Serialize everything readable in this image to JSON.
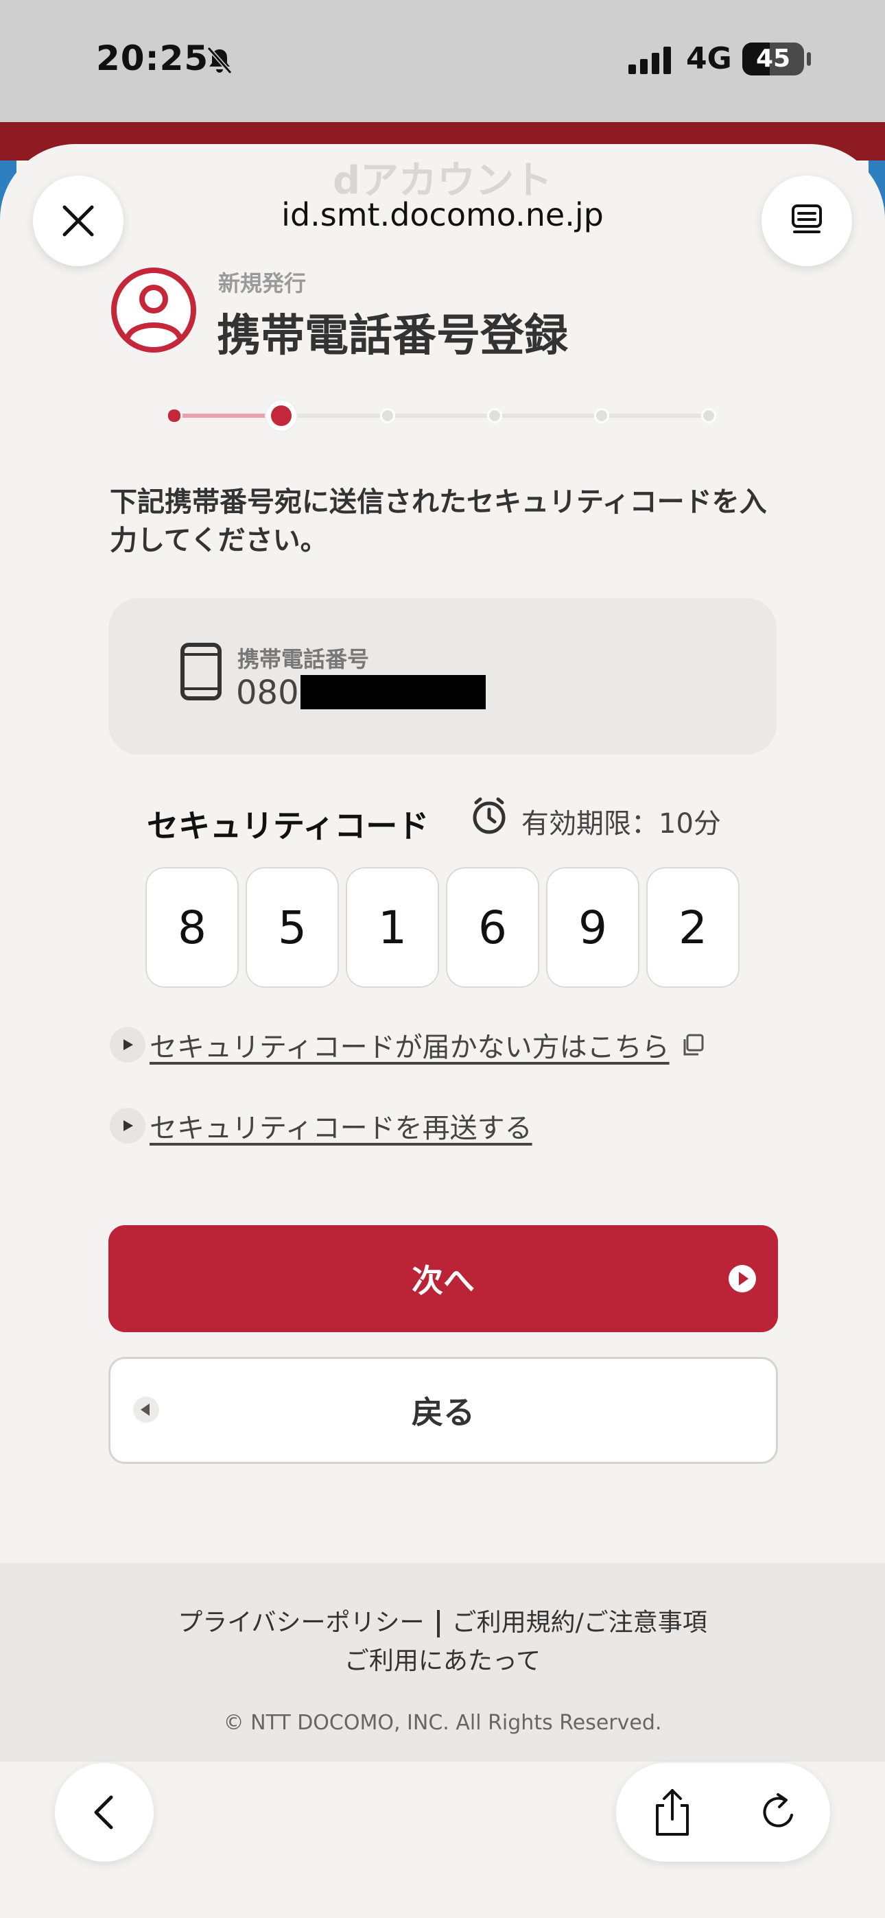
{
  "status_bar": {
    "time": "20:25",
    "network": "4G",
    "battery": "45"
  },
  "browser": {
    "ghost_title": "dアカウント",
    "url": "id.smt.docomo.ne.jp"
  },
  "header": {
    "subtitle": "新規発行",
    "title": "携帯電話番号登録"
  },
  "stepper": {
    "total_steps": 6,
    "current_step": 2
  },
  "instruction": "下記携帯番号宛に送信されたセキュリティコードを入力してください。",
  "phone": {
    "label": "携帯電話番号",
    "number_prefix": "080"
  },
  "security_code": {
    "label": "セキュリティコード",
    "expiry": "有効期限：10分",
    "digits": [
      "8",
      "5",
      "1",
      "6",
      "9",
      "2"
    ]
  },
  "links": {
    "not_received": "セキュリティコードが届かない方はこちら",
    "resend": "セキュリティコードを再送する"
  },
  "buttons": {
    "next": "次へ",
    "back": "戻る"
  },
  "footer": {
    "privacy": "プライバシーポリシー",
    "terms": "ご利用規約/ご注意事項",
    "usage": "ご利用にあたって",
    "copyright": "© NTT DOCOMO, INC. All Rights Reserved."
  },
  "colors": {
    "accent": "#bb2337",
    "stepper_active": "#c4263a"
  }
}
